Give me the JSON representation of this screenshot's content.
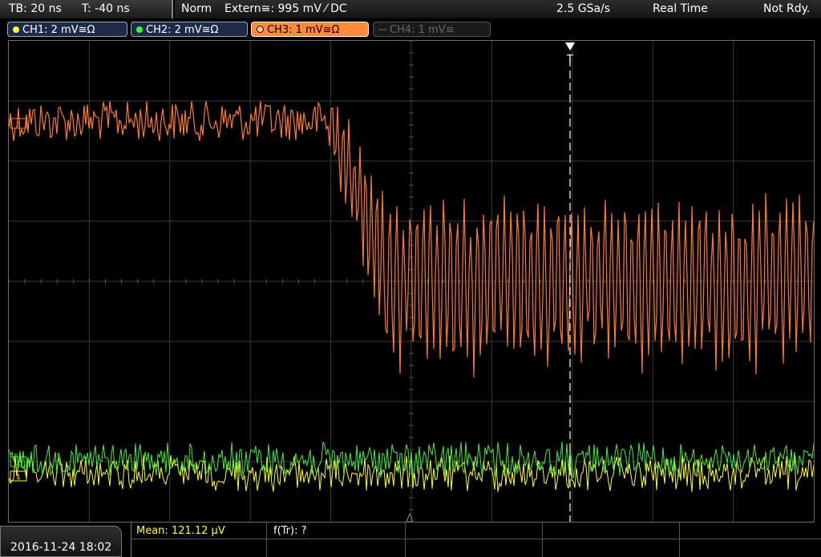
{
  "header": {
    "timebase": "TB: 20 ns",
    "trigger_time": "T: -40 ns",
    "mode": "Norm",
    "trigger_source": "Extern≅: 995 mV ⁄ DC",
    "sample_rate": "2.5 GSa/s",
    "acq_mode": "Real Time",
    "status": "Not Rdy."
  },
  "channels": [
    {
      "label": "CH1: 2 mV≅Ω",
      "color": "#ffff30",
      "active": true
    },
    {
      "label": "CH2: 2 mV≅Ω",
      "color": "#30ff30",
      "active": true
    },
    {
      "label": "CH3: 1 mV≅Ω",
      "color": "#ff8a3a",
      "active": true
    },
    {
      "label": "CH4: 1 mV≅",
      "color": "#666666",
      "active": false
    }
  ],
  "screen": {
    "trigger_marker": "T",
    "ch3_marker": "3",
    "ch2_marker": "2",
    "ch1_marker": "1"
  },
  "footer": {
    "datetime": "2016-11-24 18:02",
    "measurement_mean": "Mean: 121.12 µV",
    "measurement_ftr": "f(Tr): ?"
  },
  "colors": {
    "ch1": "#ffff30",
    "ch2": "#40ee40",
    "ch3": "#ff7a30",
    "grid": "#3a3a3a",
    "trigger_line": "#ffffff"
  }
}
